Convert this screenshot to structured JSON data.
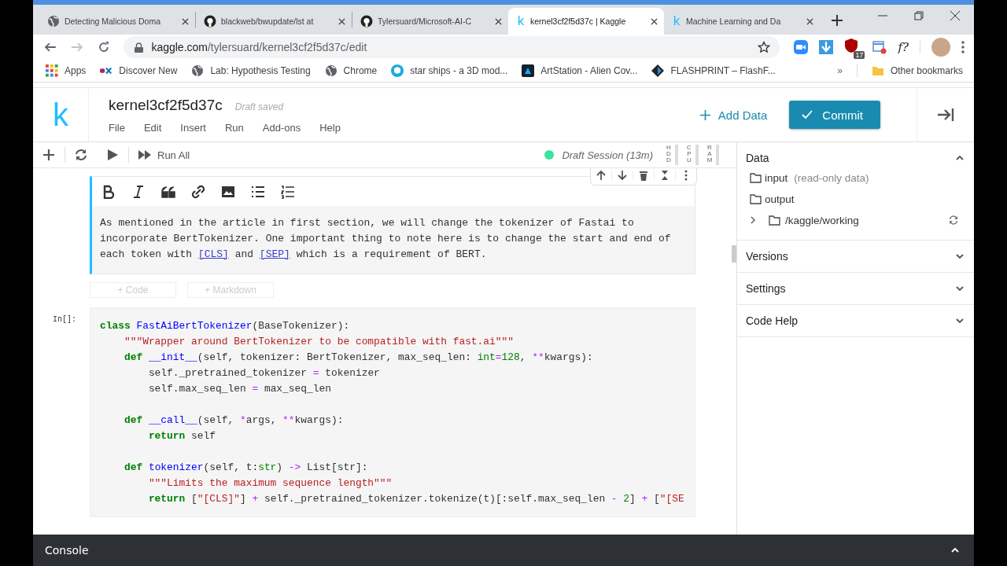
{
  "browser": {
    "tabs": [
      {
        "title": "Detecting Malicious Doma",
        "kind": "globe",
        "selected": false
      },
      {
        "title": "blackweb/bwupdate/lst at",
        "kind": "github",
        "selected": false
      },
      {
        "title": "Tylersuard/Microsoft-AI-C",
        "kind": "github",
        "selected": false
      },
      {
        "title": "kernel3cf2f5d37c | Kaggle",
        "kind": "kaggle",
        "favicon": "k",
        "selected": true
      },
      {
        "title": "Machine Learning and Da",
        "kind": "kaggle",
        "favicon": "k",
        "selected": false
      }
    ],
    "address": {
      "host": "kaggle.com",
      "path": "/tylersuard/kernel3cf2f5d37c/edit"
    },
    "extension_badge": "17",
    "extension_text": "f?",
    "bookmarks": [
      {
        "label": "Apps",
        "kind": "apps"
      },
      {
        "label": "Discover New",
        "kind": "edx"
      },
      {
        "label": "Lab: Hypothesis Testing",
        "kind": "globe"
      },
      {
        "label": "Chrome",
        "kind": "globe"
      },
      {
        "label": "star ships - a 3D mod...",
        "kind": "cube"
      },
      {
        "label": "ArtStation - Alien Cov...",
        "kind": "artstation"
      },
      {
        "label": "FLASHPRINT – FlashF...",
        "kind": "diamond"
      }
    ],
    "bookmarks_overflow": "»",
    "other_bookmarks": "Other bookmarks"
  },
  "kaggle": {
    "logo": "k",
    "title": "kernel3cf2f5d37c",
    "save_status": "Draft saved",
    "menu": [
      "File",
      "Edit",
      "Insert",
      "Run",
      "Add-ons",
      "Help"
    ],
    "add_data": "Add Data",
    "commit": "Commit"
  },
  "toolbar": {
    "run_all": "Run All",
    "session": "Draft Session (13m)",
    "meters": [
      "HDD",
      "CPU",
      "RAM"
    ]
  },
  "markdown_cell": {
    "parts": [
      {
        "kind": "text",
        "text": "As mentioned in the article in first section, we will change the tokenizer of Fastai to incorporate BertTokenizer. One important thing to note here is to change the start and end of each token with "
      },
      {
        "kind": "link",
        "text": "[CLS]"
      },
      {
        "kind": "text",
        "text": " and "
      },
      {
        "kind": "link",
        "text": "[SEP]"
      },
      {
        "kind": "text",
        "text": " which is a requirement of BERT."
      }
    ]
  },
  "add_buttons": [
    "+ Code",
    "+ Markdown"
  ],
  "code_cell": {
    "prompt": "In[]:",
    "lines": [
      {
        "kind": "code",
        "tokens": [
          {
            "kind": "kw",
            "text": "class"
          },
          {
            "kind": "name",
            "text": " FastAiBertTokenizer"
          },
          {
            "kind": "plain",
            "text": "(BaseTokenizer):"
          }
        ]
      },
      {
        "kind": "code",
        "tokens": [
          {
            "kind": "str",
            "text": "    \"\"\"Wrapper around BertTokenizer to be compatible with fast.ai\"\"\""
          }
        ]
      },
      {
        "kind": "code",
        "tokens": [
          {
            "kind": "kw",
            "text": "    def"
          },
          {
            "kind": "name",
            "text": " __init__"
          },
          {
            "kind": "plain",
            "text": "(self, tokenizer: BertTokenizer, max_seq_len: "
          },
          {
            "kind": "builtin",
            "text": "int"
          },
          {
            "kind": "op",
            "text": "="
          },
          {
            "kind": "num",
            "text": "128"
          },
          {
            "kind": "plain",
            "text": ", "
          },
          {
            "kind": "op",
            "text": "**"
          },
          {
            "kind": "plain",
            "text": "kwargs):"
          }
        ]
      },
      {
        "kind": "code",
        "tokens": [
          {
            "kind": "plain",
            "text": "        self._pretrained_tokenizer "
          },
          {
            "kind": "op",
            "text": "="
          },
          {
            "kind": "plain",
            "text": " tokenizer"
          }
        ]
      },
      {
        "kind": "code",
        "tokens": [
          {
            "kind": "plain",
            "text": "        self.max_seq_len "
          },
          {
            "kind": "op",
            "text": "="
          },
          {
            "kind": "plain",
            "text": " max_seq_len"
          }
        ]
      },
      {
        "kind": "blank"
      },
      {
        "kind": "code",
        "tokens": [
          {
            "kind": "kw",
            "text": "    def"
          },
          {
            "kind": "name",
            "text": " __call__"
          },
          {
            "kind": "plain",
            "text": "(self, "
          },
          {
            "kind": "op",
            "text": "*"
          },
          {
            "kind": "plain",
            "text": "args, "
          },
          {
            "kind": "op",
            "text": "**"
          },
          {
            "kind": "plain",
            "text": "kwargs):"
          }
        ]
      },
      {
        "kind": "code",
        "tokens": [
          {
            "kind": "kw",
            "text": "        return"
          },
          {
            "kind": "plain",
            "text": " self"
          }
        ]
      },
      {
        "kind": "blank"
      },
      {
        "kind": "code",
        "tokens": [
          {
            "kind": "kw",
            "text": "    def"
          },
          {
            "kind": "name",
            "text": " tokenizer"
          },
          {
            "kind": "plain",
            "text": "(self, t:"
          },
          {
            "kind": "builtin",
            "text": "str"
          },
          {
            "kind": "plain",
            "text": ") "
          },
          {
            "kind": "op",
            "text": "->"
          },
          {
            "kind": "plain",
            "text": " List[str]:"
          }
        ]
      },
      {
        "kind": "code",
        "tokens": [
          {
            "kind": "str",
            "text": "        \"\"\"Limits the maximum sequence length\"\"\""
          }
        ]
      },
      {
        "kind": "code",
        "tokens": [
          {
            "kind": "kw",
            "text": "        return"
          },
          {
            "kind": "plain",
            "text": " ["
          },
          {
            "kind": "str",
            "text": "\"[CLS]\""
          },
          {
            "kind": "plain",
            "text": "] "
          },
          {
            "kind": "op",
            "text": "+"
          },
          {
            "kind": "plain",
            "text": " self._pretrained_tokenizer.tokenize(t)[:self.max_seq_len "
          },
          {
            "kind": "op",
            "text": "-"
          },
          {
            "kind": "num",
            "text": " 2"
          },
          {
            "kind": "plain",
            "text": "] "
          },
          {
            "kind": "op",
            "text": "+"
          },
          {
            "kind": "plain",
            "text": " ["
          },
          {
            "kind": "str",
            "text": "\"[SE"
          }
        ]
      }
    ]
  },
  "sidebar": {
    "sections": [
      {
        "title": "Data",
        "expanded": true,
        "items": [
          {
            "kind": "folder",
            "name": "input",
            "note": "(read-only data)"
          },
          {
            "kind": "folder",
            "name": "output"
          },
          {
            "kind": "tree-folder",
            "name": "/kaggle/working"
          }
        ]
      },
      {
        "title": "Versions",
        "expanded": false
      },
      {
        "title": "Settings",
        "expanded": false
      },
      {
        "title": "Code Help",
        "expanded": false
      }
    ]
  },
  "console": {
    "title": "Console"
  }
}
